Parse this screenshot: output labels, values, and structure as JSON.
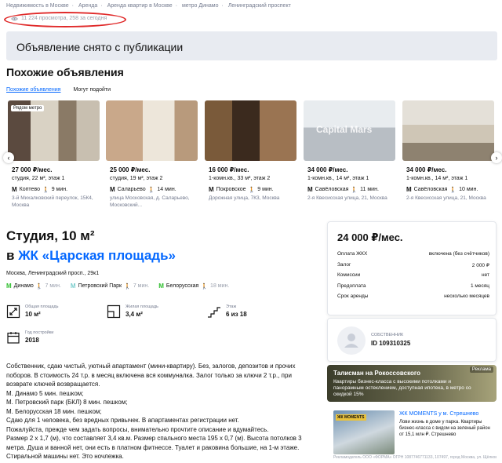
{
  "breadcrumbs": [
    "Недвижимость в Москве",
    "Аренда",
    "Аренда квартир в Москве",
    "метро Динамо",
    "Ленинградский проспект"
  ],
  "views": "11 224 просмотра, 258 за сегодня",
  "banner": "Объявление снято с публикации",
  "similar": {
    "title": "Похожие объявления",
    "tabs": [
      "Похожие объявления",
      "Могут подойти"
    ],
    "cards": [
      {
        "badge": "Рядом метро",
        "price": "27 000 ₽/мес.",
        "desc": "студия, 22 м², этаж 1",
        "metro": "Коптево",
        "time": "9 мин.",
        "addr": "3-й Михалковский переулок, 15К4, Москва"
      },
      {
        "badge": "",
        "price": "25 000 ₽/мес.",
        "desc": "студия, 19 м², этаж 2",
        "metro": "Саларьево",
        "time": "14 мин.",
        "addr": "улица Московская, д. Саларьево, Московский..."
      },
      {
        "badge": "",
        "price": "16 000 ₽/мес.",
        "desc": "1-комн.кв., 33 м², этаж 2",
        "metro": "Покровское",
        "time": "9 мин.",
        "addr": "Дорожная улица, 7К3, Москва"
      },
      {
        "badge": "",
        "price": "34 000 ₽/мес.",
        "desc": "1-комн.кв., 14 м², этаж 1",
        "metro": "Савёловская",
        "time": "11 мин.",
        "addr": "2-я Квесисская улица, 21, Москва",
        "watermark": "Capital Mars"
      },
      {
        "badge": "",
        "price": "34 000 ₽/мес.",
        "desc": "1-комн.кв., 14 м², этаж 1",
        "metro": "Савёловская",
        "time": "10 мин.",
        "addr": "2-я Квесисская улица, 21, Москва"
      }
    ]
  },
  "listing": {
    "title": "Студия, 10 м²",
    "jk_prefix": "в",
    "jk_name": "ЖК «Царская площадь»",
    "address": "Москва, Ленинградский просп., 29к1",
    "metros": [
      {
        "name": "Динамо",
        "time": "7 мин.",
        "color": "#2dbe2c"
      },
      {
        "name": "Петровский Парк",
        "time": "7 мин.",
        "color": "#79cdcd"
      },
      {
        "name": "Белорусская",
        "time": "18 мин.",
        "color": "#2dbe2c"
      }
    ],
    "facts": [
      {
        "label": "Общая площадь",
        "value": "10 м²"
      },
      {
        "label": "Жилая площадь",
        "value": "3,4 м²"
      },
      {
        "label": "Этаж",
        "value": "6 из 18"
      },
      {
        "label": "Год постройки",
        "value": "2018"
      }
    ],
    "description": [
      "Собственник, сдаю чистый, уютный апартамент (мини-квартиру). Без, залогов, депозитов и прочих поборов. В стоимость 24 т.р. в месяц включена вся коммуналка. Залог только за ключи 2 т.р., при возврате ключей возвращается.",
      "М. Динамо 5 мин. пешком;",
      "М. Петровский парк (БКЛ) 8 мин. пешком;",
      "М. Белорусская 18 мин. пешком;",
      "Сдаю для 1 человека, без вредных привычек. В апартаментах регистрации нет.",
      "Пожалуйста, прежде чем задать вопросы, внимательно прочтите описание и вдумайтесь.",
      "Размер 2 х 1,7 (м), что составляет 3,4 кв.м. Размер спального места 195 х 0,7 (м). Высота потолков 3 метра. Душа и ванной нет, они есть в платном фитнессе. Туалет и раковина большие, на 1-м этаже. Стиральной машины нет. Это ночлежка."
    ]
  },
  "price_box": {
    "price": "24 000 ₽/мес.",
    "rows": [
      {
        "k": "Оплата ЖКХ",
        "v": "включена (без счётчиков)"
      },
      {
        "k": "Залог",
        "v": "2 000 ₽"
      },
      {
        "k": "Комиссии",
        "v": "нет"
      },
      {
        "k": "Предоплата",
        "v": "1 месяц"
      },
      {
        "k": "Срок аренды",
        "v": "несколько месяцев"
      }
    ]
  },
  "owner": {
    "role": "СОБСТВЕННИК",
    "id": "ID 109310325"
  },
  "ad1": {
    "label": "Реклама",
    "title": "Талисман на Рокоссовского",
    "text": "Квартиры бизнес-класса с высокими потолками и панорамным остеклением, доступная ипотека, в метро со скидкой 15%"
  },
  "ad2": {
    "tag": "ЖК MOMENTS",
    "title": "ЖК MOMENTS у м. Стрешнево",
    "text": "Лови жизнь в доме у парка. Квартиры бизнес-класса с видом на зеленый район от 15,1 млн ₽. Стрешнево",
    "legal": "Рекламодатель ООО «ФОРМА» ОГРН 1087746771133, 107497, город Москва, ул. Щёлковское ш."
  }
}
